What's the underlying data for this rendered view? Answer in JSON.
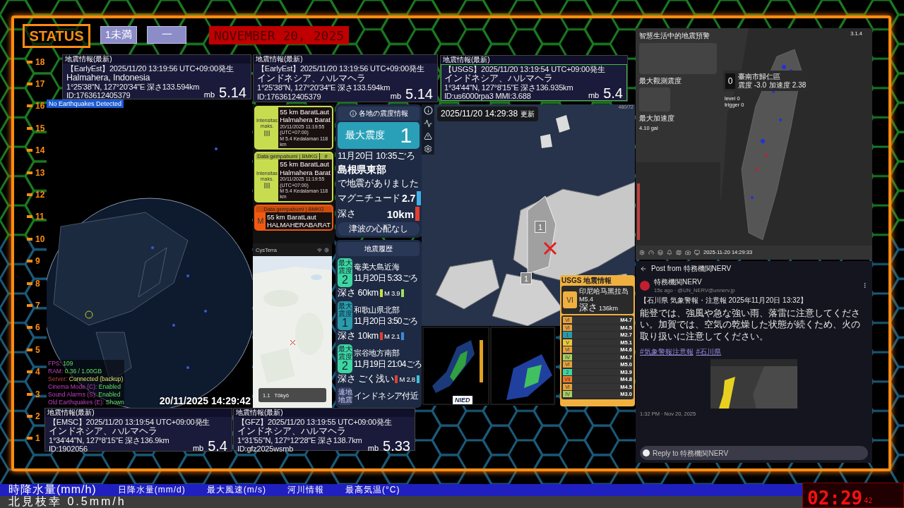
{
  "ruler": {
    "numbers": [
      "18",
      "17",
      "16",
      "15",
      "14",
      "13",
      "12",
      "11",
      "10",
      "9",
      "8",
      "7",
      "6",
      "5",
      "4",
      "3",
      "2",
      "1"
    ]
  },
  "status": {
    "label": "STATUS",
    "badges": [
      "1未満",
      "一"
    ],
    "date": "NOVEMBER 20, 2025"
  },
  "quake_cards": [
    {
      "title": "地震情報(最新)",
      "lines": [
        "【EarlyEst】2025/11/20  13:19:56  UTC+09:00発生",
        "Halmahera, Indonesia",
        "1°25'38\"N,  127°20'34\"E   深さ133.594km"
      ],
      "id": "ID:1763612405379",
      "unit": "mb",
      "magnitude": "5.14",
      "highlighted": false
    },
    {
      "title": "地震情報(最新)",
      "lines": [
        "【EarlyEst】2025/11/20  13:19:56  UTC+09:00発生",
        "インドネシア、ハルマヘラ",
        "1°25'38\"N,  127°20'34\"E   深さ133.594km"
      ],
      "id": "ID:1763612405379",
      "unit": "mb",
      "magnitude": "5.14",
      "highlighted": false
    },
    {
      "title": "地震情報(最新)",
      "lines": [
        "【USGS】2025/11/20  13:19:54  UTC+09:00発生",
        "インドネシア、ハルマヘラ",
        "1°34'44\"N,  127°8'15\"E   深さ136.935km"
      ],
      "id": "ID:us6000rpa3 MMI:3.688",
      "unit": "mb",
      "magnitude": "5.4",
      "highlighted": true
    },
    {
      "title": "地震情報(最新)",
      "lines": [
        "【EMSC】2025/11/20  13:19:54  UTC+09:00発生",
        "インドネシア、ハルマヘラ",
        "1°34'44\"N,  127°8'15\"E   深さ136.9km"
      ],
      "id": "ID:1902056",
      "unit": "mb",
      "magnitude": "5.4",
      "highlighted": false
    },
    {
      "title": "地震情報(最新)",
      "lines": [
        "【GFZ】2025/11/20  13:19:55  UTC+09:00発生",
        "インドネシア、ハルマヘラ",
        "1°31'55\"N,  127°12'28\"E   深さ138.7km"
      ],
      "id": "ID:gfz2025wsmb",
      "unit": "mb",
      "magnitude": "5.33",
      "highlighted": false
    }
  ],
  "globe": {
    "badge": "No Earthquakes Detected",
    "stats": [
      {
        "label": "FPS:",
        "value": "109"
      },
      {
        "label": "RAM:",
        "value": "0.36 / 1.00GB"
      },
      {
        "label": "Server:",
        "value": "Connected (backup)"
      },
      {
        "label": "Cinema Mode (C):",
        "value": "Enabled"
      },
      {
        "label": "Sound Alarms (S):",
        "value": "Enabled"
      },
      {
        "label": "Old Earthquakes (E):",
        "value": "Shown"
      }
    ],
    "timestamp": "20/11/2025 14:29:42"
  },
  "bmkg": {
    "cards": [
      {
        "kind": "full",
        "color": "#c8dc50",
        "intensity_label": "Intensitas maks.",
        "intensity": "III",
        "lines": [
          "55 km BaratLaut",
          "Halmahera Barat"
        ],
        "date": "20/11/2025 11:19:55 (UTC+07:00)",
        "detail": "M 5.4    Kedalaman 118 km"
      },
      {
        "kind": "headed",
        "color": "#c8dc50",
        "header": "Data gempabumi | BMKG",
        "header_mark": "#",
        "intensity_label": "Intensitas maks.",
        "intensity": "III",
        "lines": [
          "55 km BaratLaut",
          "Halmahera Barat"
        ],
        "date": "20/11/2025 11:19:55 (UTC+07:00)",
        "detail": "M 5.4    Kedalaman 118 km"
      },
      {
        "kind": "cut",
        "color": "#f05a10",
        "header": "Data gempabumi | BMKG",
        "intensity": "M",
        "lines": [
          "55 km BaratLaut",
          "HALMAHERABARAT"
        ]
      }
    ]
  },
  "cysterra": {
    "title": "CysTerra",
    "popup_value": "1.1",
    "popup_place": "Tōkyō"
  },
  "shindo": {
    "title": "各地の震度情報",
    "max_label": "最大震度",
    "max_value": "1",
    "time": "11月20日 10:35ごろ",
    "place": "島根県東部",
    "note": "で地震がありました",
    "magnitude_label": "マグニチュード",
    "magnitude": "2.7",
    "depth_label": "深さ",
    "depth": "10km",
    "tsunami": "津波の心配なし"
  },
  "history": {
    "title": "地震履歴",
    "items": [
      {
        "kind": "full",
        "badge_label": "最大震度",
        "shindo": "2",
        "color": "#3ed6a0",
        "place": "奄美大島近海",
        "time": "11月20日 5:33ごろ",
        "depth_label": "深さ",
        "depth": "60km",
        "depth_bar": {
          "color": "#c8e040"
        },
        "mag_label": "M",
        "magnitude": "3.9",
        "mag_bar": {
          "color": "#a0e060"
        }
      },
      {
        "kind": "full",
        "badge_label": "最大震度",
        "shindo": "1",
        "color": "#2a9aaa",
        "place": "和歌山県北部",
        "time": "11月20日 3:50ごろ",
        "depth_label": "深さ",
        "depth": "10km",
        "depth_bar": {
          "color": "#e04030"
        },
        "mag_label": "M",
        "magnitude": "2.1",
        "mag_bar": {
          "color": "#3a8ae0"
        }
      },
      {
        "kind": "full",
        "badge_label": "最大震度",
        "shindo": "2",
        "color": "#3ed6a0",
        "place": "宗谷地方南部",
        "time": "11月19日 21:04ごろ",
        "depth_label": "深さ",
        "depth": "ごく浅い",
        "depth_bar": {
          "color": "#e04030"
        },
        "mag_label": "M",
        "magnitude": "2.8",
        "mag_bar": {
          "color": "#40c0e0"
        }
      },
      {
        "kind": "partial",
        "badge_label": "遠地地震",
        "color": "#34406a",
        "place": "インドネシア付近"
      }
    ]
  },
  "jp_map": {
    "timestamp": "2025/11/20 14:29:38",
    "suffix": "更新",
    "corner": "460/72",
    "markers": [
      "1",
      "1"
    ]
  },
  "nied": {
    "logo": "NIED"
  },
  "usgs": {
    "title": "USGS 地震情報",
    "shindo": "VI",
    "place": "印尼哈马黑拉岛",
    "magnitude": "M5.4",
    "depth_label": "深さ",
    "depth": "136km",
    "rows": [
      {
        "shindo": "VI",
        "magnitude": "M4.7",
        "color": "#e8a23c"
      },
      {
        "shindo": "VI",
        "magnitude": "M4.5",
        "color": "#e8a23c"
      },
      {
        "shindo": "1",
        "magnitude": "M2.7",
        "color": "#2a9aaa"
      },
      {
        "shindo": "V",
        "magnitude": "M5.1",
        "color": "#e8c83c"
      },
      {
        "shindo": "VI",
        "magnitude": "M4.6",
        "color": "#e8a23c"
      },
      {
        "shindo": "IV",
        "magnitude": "M4.7",
        "color": "#a8d060"
      },
      {
        "shindo": "VI",
        "magnitude": "M5.0",
        "color": "#e8a23c"
      },
      {
        "shindo": "2",
        "magnitude": "M3.9",
        "color": "#3ed6a0"
      },
      {
        "shindo": "VII",
        "magnitude": "M4.8",
        "color": "#f07a28"
      },
      {
        "shindo": "VI",
        "magnitude": "M4.5",
        "color": "#e8a23c"
      },
      {
        "shindo": "IV",
        "magnitude": "M3.0",
        "color": "#a8d060"
      }
    ]
  },
  "taiwan": {
    "title": "智慧生活中的地震預警",
    "version": "3.1.4",
    "max_intensity_label": "最大觀測震度",
    "max_accel_label": "最大加速度",
    "max_accel": "4.10 gal",
    "station_value": "0",
    "station_name": "臺南市歸仁區",
    "station_intensity": "震度 -3.0",
    "station_accel": "加速度 2.38",
    "stats": [
      {
        "label": "level",
        "value": "0"
      },
      {
        "label": "trigger",
        "value": "0"
      }
    ],
    "timestamp": "2025-11-20 14:29:33"
  },
  "nerv": {
    "header": "Post from 特務機関NERV",
    "author": "特務機関NERV",
    "meta": "15s ago · @UN_NERV@unnerv.jp",
    "title": "【石川県 気象警報・注意報 2025年11月20日 13:32】",
    "body": "能登では、強風や急な強い雨、落雷に注意してください。加賀では、空気の乾燥した状態が続くため、火の取り扱いに注意してください。",
    "hashtags": [
      "#気象警報注意報",
      "#石川県"
    ],
    "posted": "1:32 PM · Nov 20, 2025",
    "reply_placeholder": "Reply to 特務機関NERV"
  },
  "ticker": {
    "headings": [
      "時降水量(mm/h)",
      "日降水量(mm/d)",
      "最大風速(m/s)",
      "河川情報",
      "最高気温(°C)"
    ],
    "message": "北見枝幸 0.5mm/h"
  },
  "clock": {
    "time": "02:29",
    "seconds": "42"
  }
}
